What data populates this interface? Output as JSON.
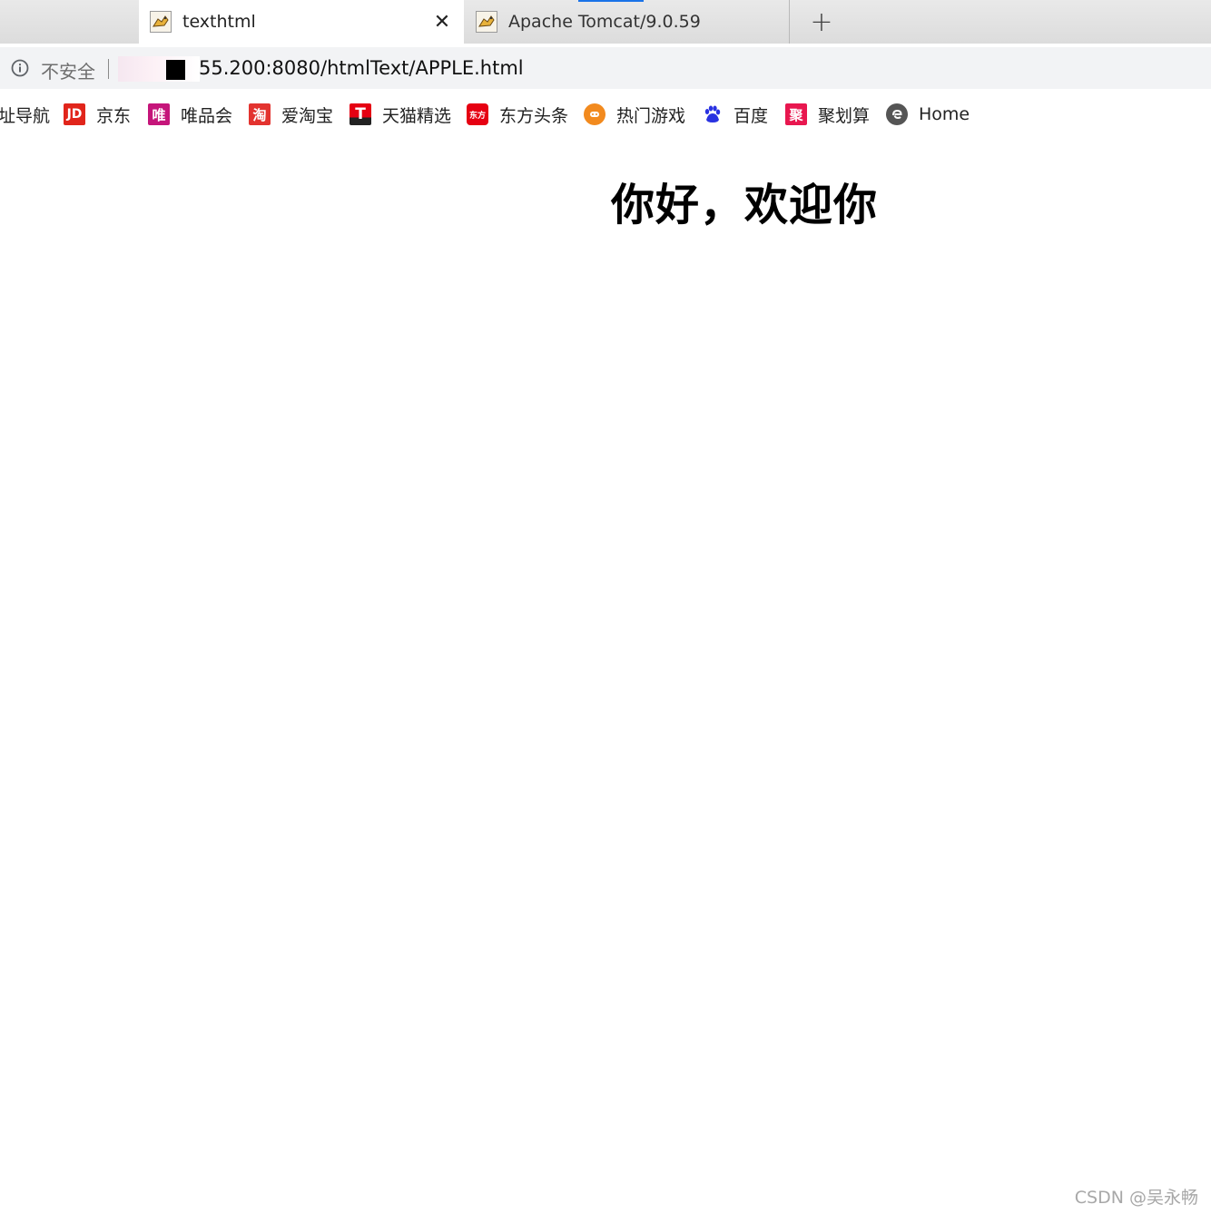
{
  "tabs": [
    {
      "title": "texthtml",
      "active": true,
      "favicon": "tomcat-icon"
    },
    {
      "title": "Apache Tomcat/9.0.59",
      "active": false,
      "favicon": "tomcat-icon"
    }
  ],
  "tab_close_glyph": "✕",
  "new_tab_glyph": "+",
  "address": {
    "security_label": "不安全",
    "url_visible": "55.200:8080/htmlText/APPLE.html"
  },
  "bookmarks": [
    {
      "label": "址导航",
      "icon": "none",
      "icon_color": ""
    },
    {
      "label": "京东",
      "icon": "jd-icon",
      "icon_text": "JD",
      "icon_color": "#e1251b"
    },
    {
      "label": "唯品会",
      "icon": "vip-icon",
      "icon_text": "唯",
      "icon_color": "#c5157a"
    },
    {
      "label": "爱淘宝",
      "icon": "taobao-icon",
      "icon_text": "淘",
      "icon_color": "#e3332f"
    },
    {
      "label": "天猫精选",
      "icon": "tmall-icon",
      "icon_text": "T",
      "icon_color": "#e50012"
    },
    {
      "label": "东方头条",
      "icon": "dongfang-icon",
      "icon_text": "东方",
      "icon_color": "#e60012"
    },
    {
      "label": "热门游戏",
      "icon": "game-icon",
      "icon_text": "",
      "icon_color": "#f28a1e"
    },
    {
      "label": "百度",
      "icon": "baidu-paw-icon",
      "icon_text": "",
      "icon_color": "#2932e1"
    },
    {
      "label": "聚划算",
      "icon": "juhuasuan-icon",
      "icon_text": "聚",
      "icon_color": "#e8174f"
    },
    {
      "label": "Home",
      "icon": "edge-home-icon",
      "icon_text": "",
      "icon_color": "#555555"
    }
  ],
  "page": {
    "heading": "你好，欢迎你"
  },
  "watermark": "CSDN @吴永畅"
}
